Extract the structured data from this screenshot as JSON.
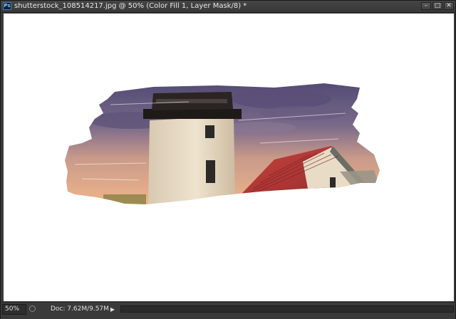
{
  "window": {
    "title": "shutterstock_108514217.jpg @ 50% (Color Fill 1, Layer Mask/8) *",
    "app_icon_label": "Ps",
    "controls": {
      "minimize": "–",
      "restore": "□",
      "close": "✕"
    }
  },
  "status_bar": {
    "zoom_value": "50%",
    "doc_info": "Doc: 7.62M/9.57M",
    "menu_arrow": "▶"
  },
  "icons": [
    "photoshop-icon",
    "minimize-icon",
    "restore-icon",
    "close-icon",
    "status-icon",
    "arrow-right-icon"
  ],
  "colors": {
    "canvas_background": "#ffffff",
    "chrome": "#3a3a3a",
    "sky_purple": "#6b5f8a",
    "roof_red": "#b33a3a",
    "tower_cream": "#e2d6c2"
  }
}
